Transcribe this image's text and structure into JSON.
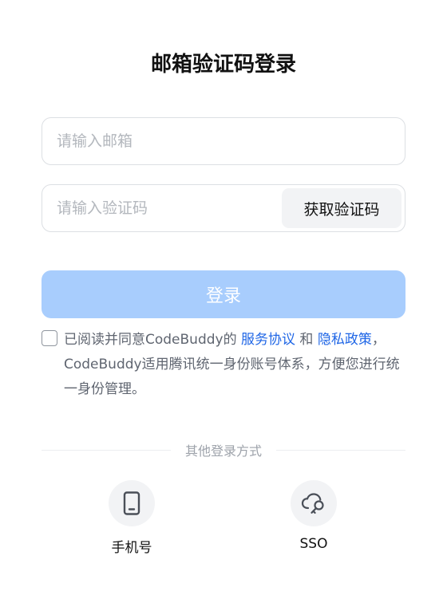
{
  "title": "邮箱验证码登录",
  "email": {
    "placeholder": "请输入邮箱",
    "value": ""
  },
  "code": {
    "placeholder": "请输入验证码",
    "value": "",
    "get_code_label": "获取验证码"
  },
  "login_label": "登录",
  "agreement": {
    "checked": false,
    "prefix": "已阅读并同意CodeBuddy的",
    "terms_link": "服务协议",
    "and": "和",
    "privacy_link": "隐私政策",
    "suffix": "，CodeBuddy适用腾讯统一身份账号体系，方便您进行统一身份管理。"
  },
  "other_methods": {
    "label": "其他登录方式",
    "options": [
      {
        "label": "手机号",
        "icon": "phone-icon"
      },
      {
        "label": "SSO",
        "icon": "cloud-key-icon"
      }
    ]
  },
  "colors": {
    "primary_disabled": "#a8cdfd",
    "link": "#1f66e6"
  }
}
